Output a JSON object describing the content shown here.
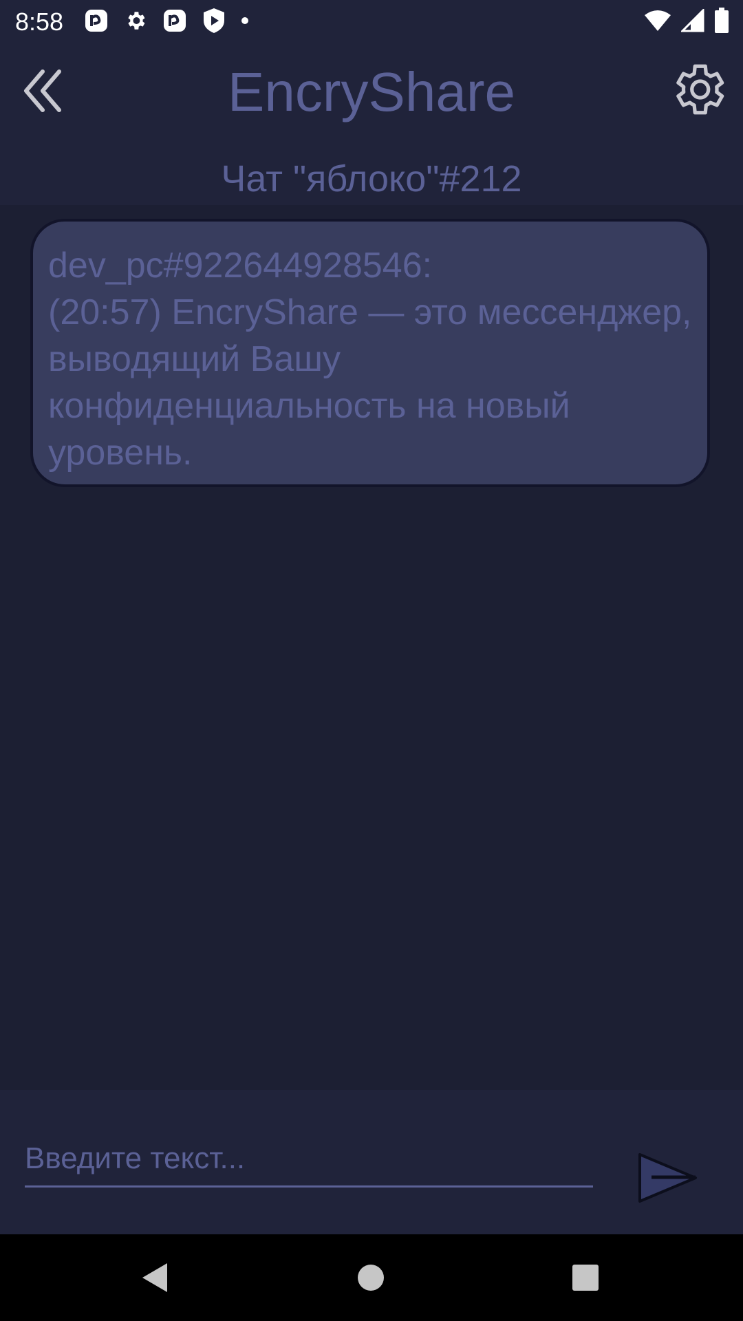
{
  "status_bar": {
    "time": "8:58",
    "left_icons": [
      "app-notification-icon",
      "gear-icon",
      "app-notification-icon",
      "shield-play-icon",
      "dot-icon"
    ],
    "right_icons": [
      "wifi-icon",
      "cell-signal-icon",
      "battery-icon"
    ]
  },
  "header": {
    "back_icon": "double-chevron-left-icon",
    "title": "EncryShare",
    "settings_icon": "gear-icon",
    "chat_name": "Чат \"яблоко\"#212"
  },
  "messages": [
    {
      "text": "dev_pc#922644928546:\n(20:57) EncryShare — это мессенджер, выводящий Вашу конфиденциальность на новый уровень."
    }
  ],
  "composer": {
    "placeholder": "Введите текст...",
    "value": "",
    "send_icon": "send-arrow-icon"
  },
  "nav": {
    "back_icon": "triangle-back-icon",
    "home_icon": "circle-home-icon",
    "recents_icon": "square-recents-icon"
  },
  "colors": {
    "background": "#1c1f33",
    "header": "#20233a",
    "accent_text": "#5b6196",
    "bubble": "#383d5e"
  }
}
